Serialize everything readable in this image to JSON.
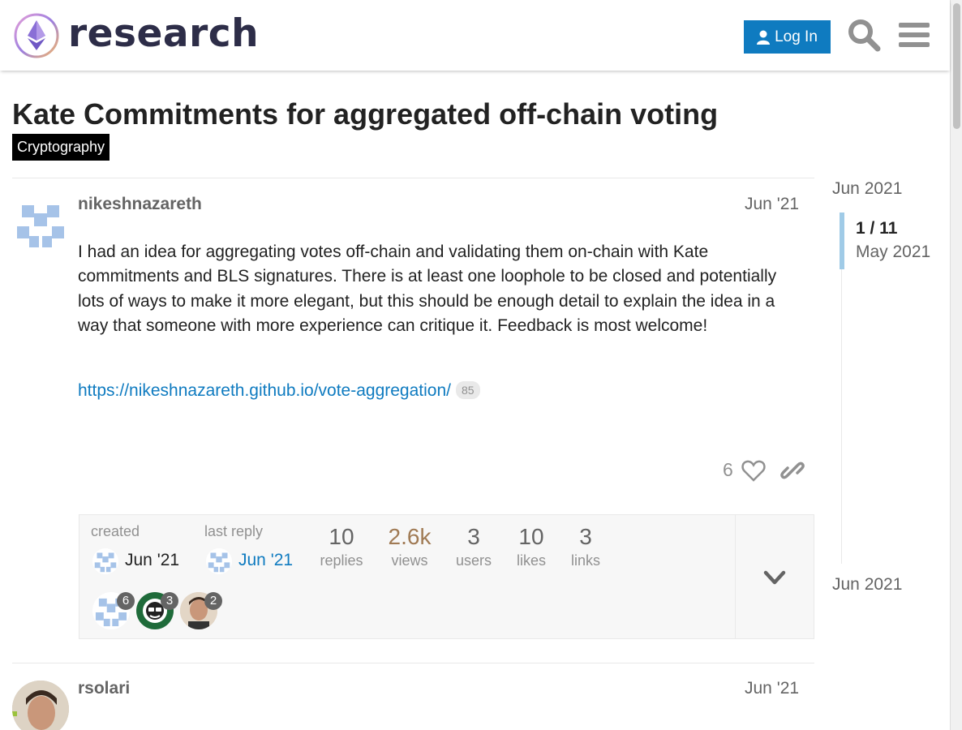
{
  "header": {
    "logo_text": "research",
    "login_label": "Log In"
  },
  "topic": {
    "title": "Kate Commitments for aggregated off-chain voting",
    "category": "Cryptography"
  },
  "post1": {
    "username": "nikeshnazareth",
    "date": "Jun '21",
    "body": "I had an idea for aggregating votes off-chain and validating them on-chain with Kate commitments and BLS signatures. There is at least one loophole to be closed and potentially lots of ways to make it more elegant, but this should be enough detail to explain the idea in a way that someone with more experience can critique it. Feedback is most welcome!",
    "link_text": "https://nikeshnazareth.github.io/vote-aggregation/",
    "link_clicks": "85",
    "likes": "6"
  },
  "topic_map": {
    "created_label": "created",
    "created_date": "Jun '21",
    "last_reply_label": "last reply",
    "last_reply_date": "Jun '21",
    "stats": [
      {
        "value": "10",
        "label": "replies"
      },
      {
        "value": "2.6k",
        "label": "views"
      },
      {
        "value": "3",
        "label": "users"
      },
      {
        "value": "10",
        "label": "likes"
      },
      {
        "value": "3",
        "label": "links"
      }
    ],
    "participants": [
      {
        "count": "6"
      },
      {
        "count": "3"
      },
      {
        "count": "2"
      }
    ]
  },
  "timeline": {
    "start_date": "Jun 2021",
    "position": "1 / 11",
    "position_date": "May 2021",
    "end_date": "Jun 2021"
  },
  "post2": {
    "username": "rsolari",
    "date": "Jun '21"
  },
  "colors": {
    "accent": "#0f7bc0",
    "views": "#a07a54"
  }
}
